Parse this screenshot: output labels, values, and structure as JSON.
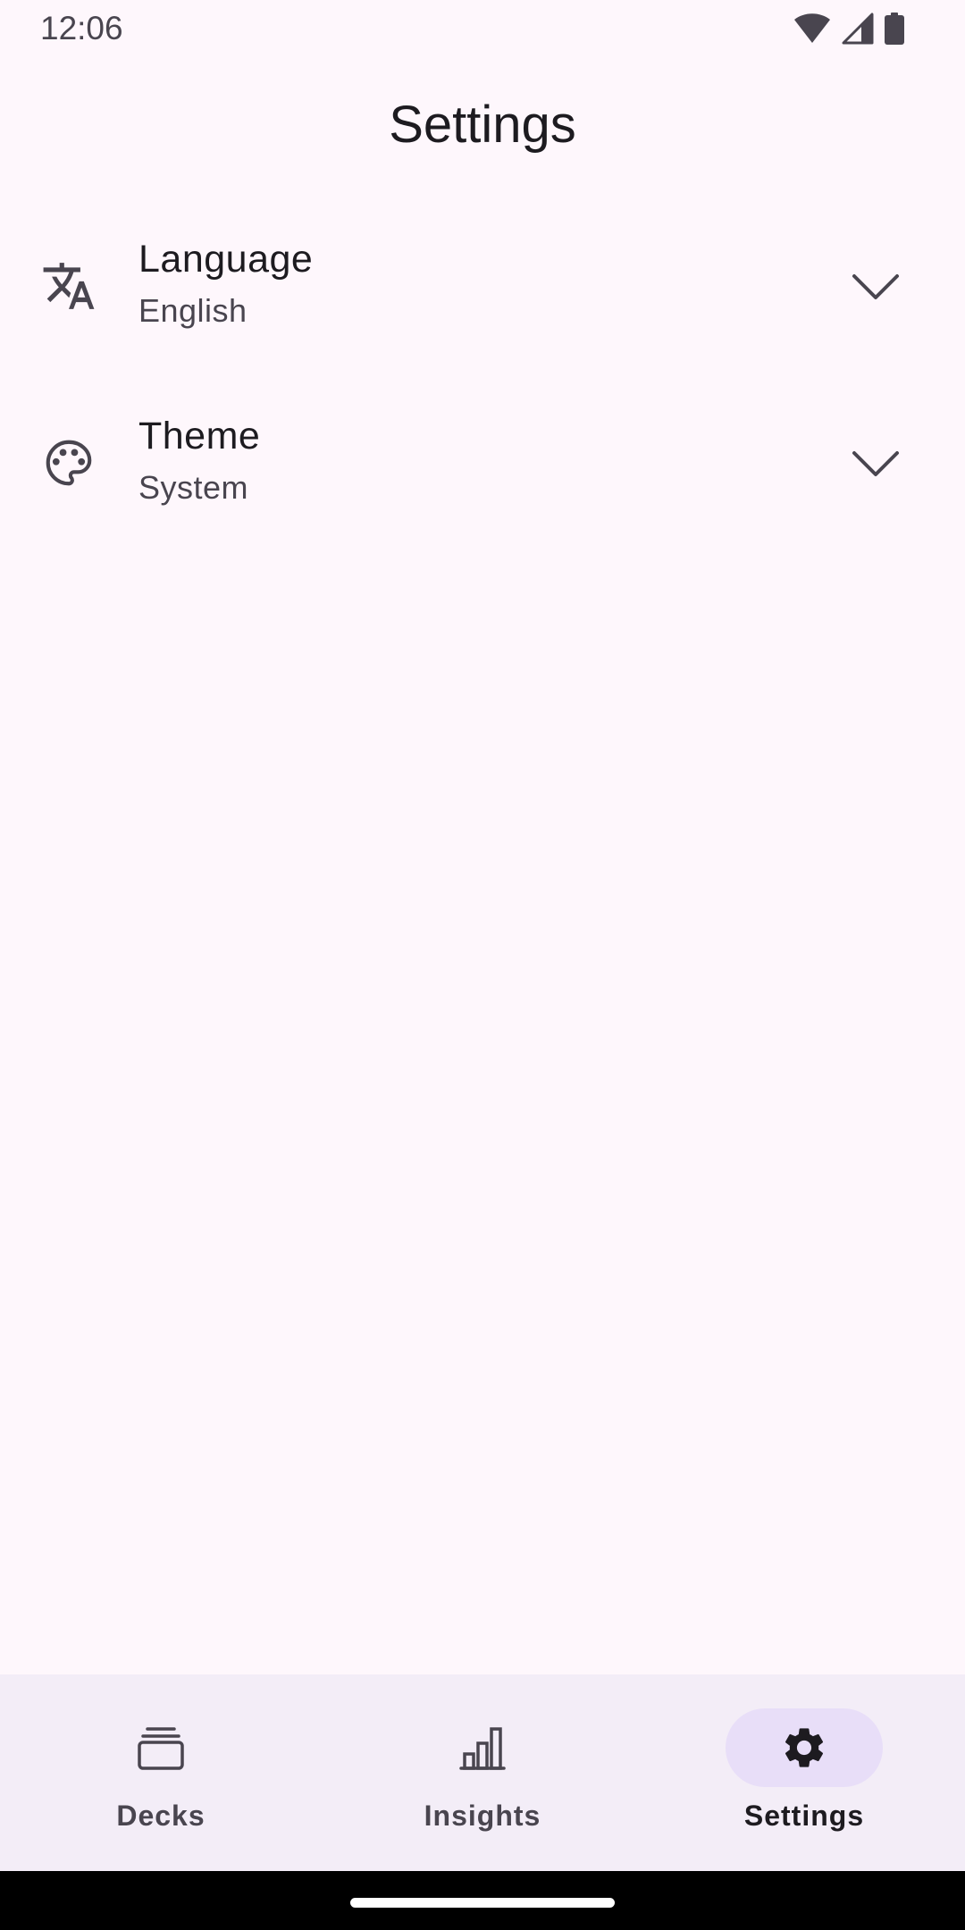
{
  "status_bar": {
    "time": "12:06",
    "icons": [
      "wifi-icon",
      "cellular-signal-icon",
      "battery-icon"
    ]
  },
  "header": {
    "title": "Settings"
  },
  "settings": [
    {
      "icon": "translate-icon",
      "title": "Language",
      "value": "English"
    },
    {
      "icon": "palette-icon",
      "title": "Theme",
      "value": "System"
    }
  ],
  "bottom_nav": {
    "items": [
      {
        "icon": "decks-icon",
        "label": "Decks",
        "selected": false
      },
      {
        "icon": "bar-chart-icon",
        "label": "Insights",
        "selected": false
      },
      {
        "icon": "gear-icon",
        "label": "Settings",
        "selected": true
      }
    ]
  },
  "colors": {
    "background": "#FEF7FC",
    "nav_background": "#F3EDF7",
    "nav_indicator": "#E8DEF8",
    "text_primary": "#1D1B20",
    "text_secondary": "#49454F"
  }
}
